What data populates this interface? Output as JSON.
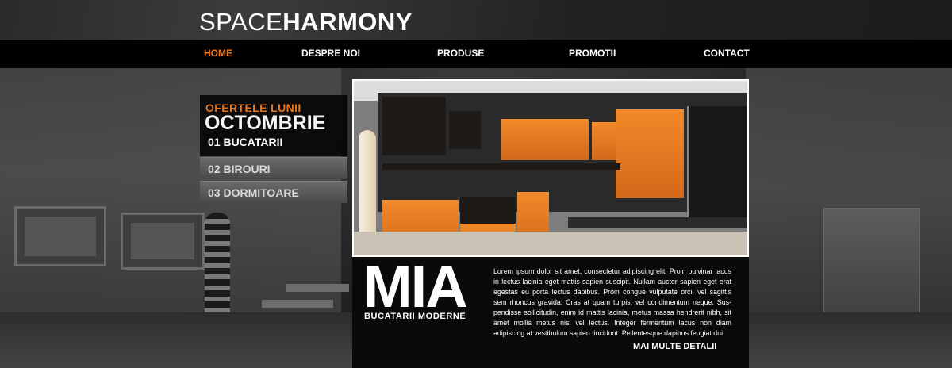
{
  "logo": {
    "light": "SPACE",
    "bold": "HARMONY"
  },
  "nav": {
    "items": [
      "HOME",
      "DESPRE NOI",
      "PRODUSE",
      "PROMOTII",
      "CONTACT"
    ],
    "active": "HOME"
  },
  "offer": {
    "subtitle": "OFERTELE LUNII",
    "month": "OCTOMBRIE",
    "categories": [
      "01 BUCATARII",
      "02 BIROURI",
      "03 DORMITOARE"
    ],
    "active_category": "01 BUCATARII"
  },
  "promo": {
    "title": "MIA",
    "subtitle": "BUCATARII MODERNE",
    "description": "Lorem ipsum dolor sit amet, consectetur adipiscing elit. Proin pulvinar lacus in lectus lacinia eget mattis sapien suscipit. Nullam auctor sapien eget erat egestas eu porta lectus dapibus. Proin congue vulputate orci, vel sagittis sem rhoncus gravida. Cras at quam turpis, vel condimentum neque. Sus-pendisse sollicitudin, enim id mattis lacinia, metus massa hendrerit nibh, sit amet mollis metus nisl vel lectus. Integer fermentum lacus non diam adipiscing at vestibulum sapien tincidunt. Pellentesque dapibus feugiat dui",
    "more_link": "MAI MULTE DETALII"
  },
  "colors": {
    "accent": "#f07a1c",
    "nav_bg": "#000000",
    "text": "#ffffff"
  }
}
